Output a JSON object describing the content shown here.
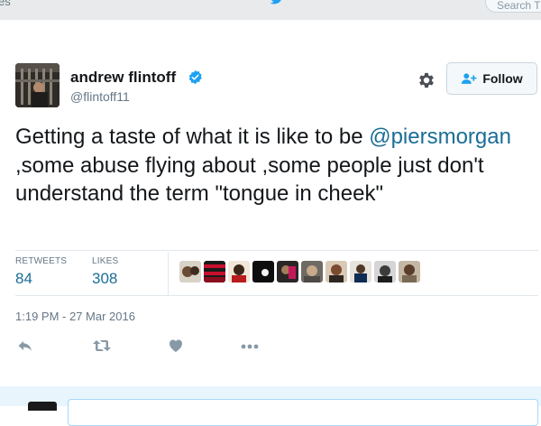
{
  "nav": {
    "left_partial": "es",
    "search_placeholder": "Search T"
  },
  "tweet": {
    "author_name": "andrew flintoff",
    "handle": "@flintoff11",
    "verified": true,
    "follow_label": "Follow",
    "text_before": "Getting a taste of what it is like to be ",
    "mention": "@piersmorgan",
    "text_after": " ,some abuse flying about ,some people just don't understand the term \"tongue in cheek\"",
    "retweets_label": "RETWEETS",
    "retweets_count": "84",
    "likes_label": "LIKES",
    "likes_count": "308",
    "timestamp": "1:19 PM - 27 Mar 2016"
  },
  "actions": [
    {
      "icon": "reply-icon"
    },
    {
      "icon": "retweet-icon"
    },
    {
      "icon": "like-heart-icon"
    },
    {
      "icon": "more-dots-icon"
    }
  ],
  "colors": {
    "link": "#1b6d96",
    "verified": "#1da1f2",
    "muted": "#657786",
    "reply_bar": "#e8f5fd",
    "follow_icon": "#1da1f2"
  }
}
